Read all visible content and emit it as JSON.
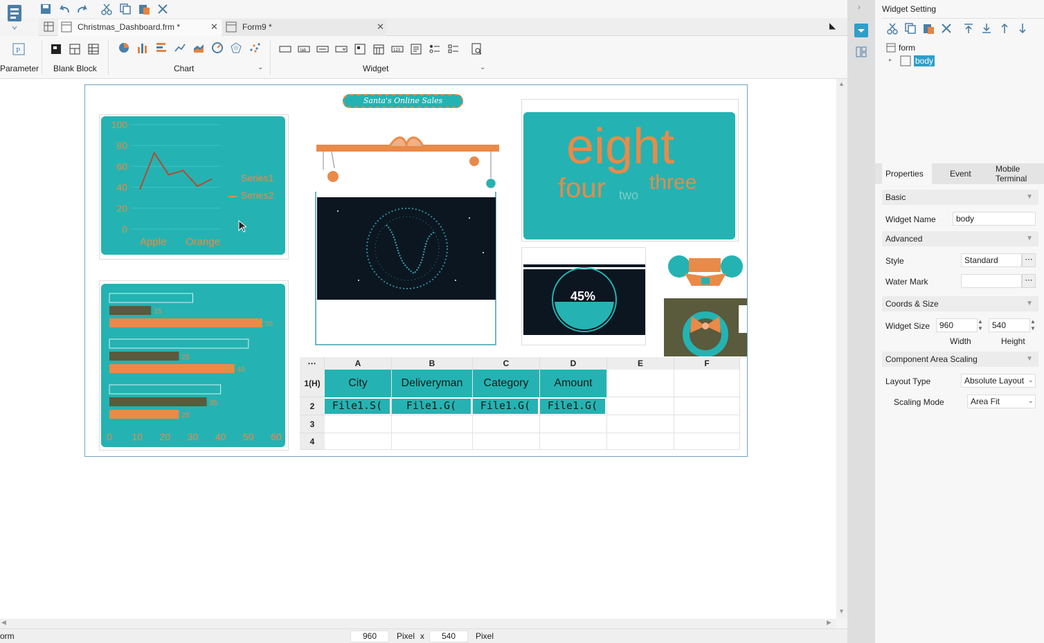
{
  "tabs": [
    {
      "label": "Christmas_Dashboard.frm *"
    },
    {
      "label": "Form9 *"
    }
  ],
  "ribbon": {
    "parameter_label": "Parameter",
    "blank_block_label": "Blank Block",
    "chart_label": "Chart",
    "widget_label": "Widget"
  },
  "dashboard": {
    "title_banner": "Santa's Online Sales",
    "line_chart": {
      "yticks": [
        "100",
        "80",
        "60",
        "40",
        "20",
        "0"
      ],
      "categories": [
        "Apple",
        "Orange"
      ],
      "legend": [
        "Series1",
        "Series2"
      ]
    },
    "bar_chart": {
      "xticks": [
        "0",
        "10",
        "20",
        "30",
        "40",
        "50",
        "60"
      ],
      "labels": [
        "15",
        "55",
        "25",
        "45",
        "35",
        "25"
      ]
    },
    "word_cloud": [
      "eight",
      "four",
      "two",
      "three"
    ],
    "gauge_value": "45%",
    "sheet": {
      "col_headers": [
        "A",
        "B",
        "C",
        "D",
        "E",
        "F"
      ],
      "row_headers": [
        "1(H)",
        "2",
        "3",
        "4"
      ],
      "header_row": [
        "City",
        "Deliveryman",
        "Category",
        "Amount"
      ],
      "data_row": [
        "File1.S(",
        "File1.G(",
        "File1.G(",
        "File1.G("
      ]
    }
  },
  "chart_data": [
    {
      "type": "line",
      "categories": [
        "Apple",
        "Orange"
      ],
      "ylim": [
        0,
        100
      ],
      "series": [
        {
          "name": "Series1",
          "values": [
            38,
            73,
            52,
            56,
            41,
            48
          ]
        },
        {
          "name": "Series2",
          "values": []
        }
      ]
    },
    {
      "type": "bar",
      "xlim": [
        0,
        60
      ],
      "series": [
        {
          "values": [
            30,
            15,
            55
          ]
        },
        {
          "values": [
            50,
            25,
            45
          ]
        },
        {
          "values": [
            40,
            35,
            25
          ]
        }
      ]
    }
  ],
  "status": {
    "left_text": "orm",
    "width_value": "960",
    "width_unit": "Pixel",
    "times": "x",
    "height_value": "540",
    "height_unit": "Pixel"
  },
  "panel": {
    "title": "Widget Setting",
    "tree": {
      "root": "form",
      "child": "body"
    },
    "tabs": {
      "properties": "Properties",
      "event": "Event",
      "mobile": "Mobile Terminal"
    },
    "basic_header": "Basic",
    "widget_name_label": "Widget Name",
    "widget_name_value": "body",
    "advanced_header": "Advanced",
    "style_label": "Style",
    "style_value": "Standard",
    "watermark_label": "Water Mark",
    "watermark_value": "",
    "coords_header": "Coords & Size",
    "widget_size_label": "Widget Size",
    "width_value": "960",
    "height_value": "540",
    "width_caption": "Width",
    "height_caption": "Height",
    "scaling_header": "Component Area Scaling",
    "layout_type_label": "Layout Type",
    "layout_type_value": "Absolute Layout",
    "scaling_mode_label": "Scaling Mode",
    "scaling_mode_value": "Area Fit"
  },
  "colors": {
    "teal": "#24b3b2",
    "orange": "#ea8a48",
    "dark": "#0b1620",
    "olive": "#5a5a3c"
  }
}
